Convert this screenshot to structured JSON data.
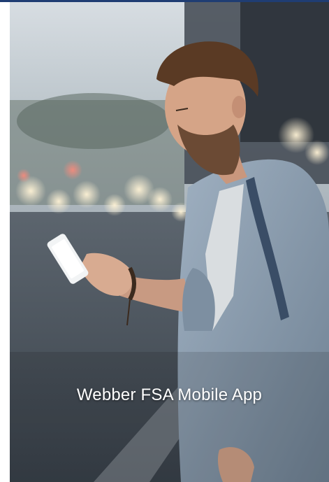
{
  "hero": {
    "caption": "Webber FSA Mobile App"
  },
  "colors": {
    "top_rule": "#1f3d73",
    "caption_text": "#ffffff",
    "jacket": "#8a9bad",
    "sky": "#c9d2d8",
    "street": "#4b545e"
  },
  "icons": {
    "phone": "smartphone-icon"
  }
}
